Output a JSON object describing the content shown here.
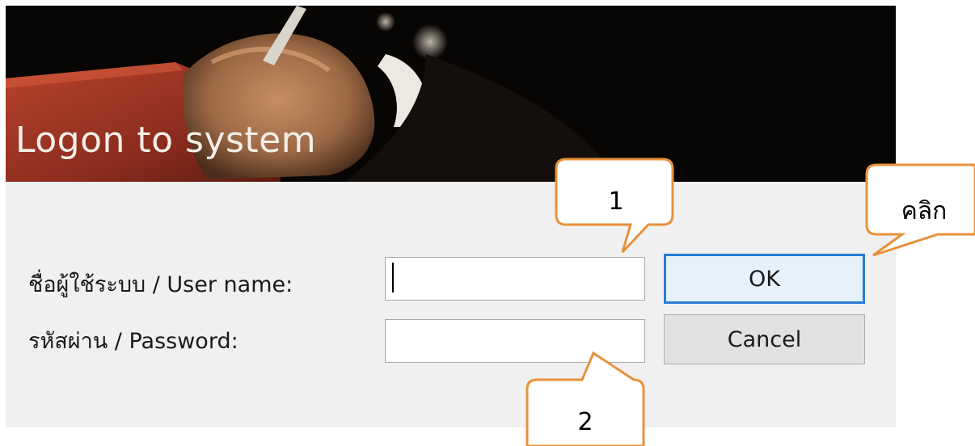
{
  "banner": {
    "title": "Logon to system"
  },
  "form": {
    "username_label": "ชื่อผู้ใช้ระบบ / User name:",
    "username_value": "",
    "password_label": "รหัสผ่าน / Password:",
    "password_value": ""
  },
  "buttons": {
    "ok_label": "OK",
    "cancel_label": "Cancel"
  },
  "callouts": {
    "step1": "1",
    "step2": "2",
    "click": "คลิก"
  },
  "colors": {
    "callout_border": "#e8913a",
    "ok_focus": "#2a7bd4",
    "dialog_bg": "#f0f0f0"
  }
}
